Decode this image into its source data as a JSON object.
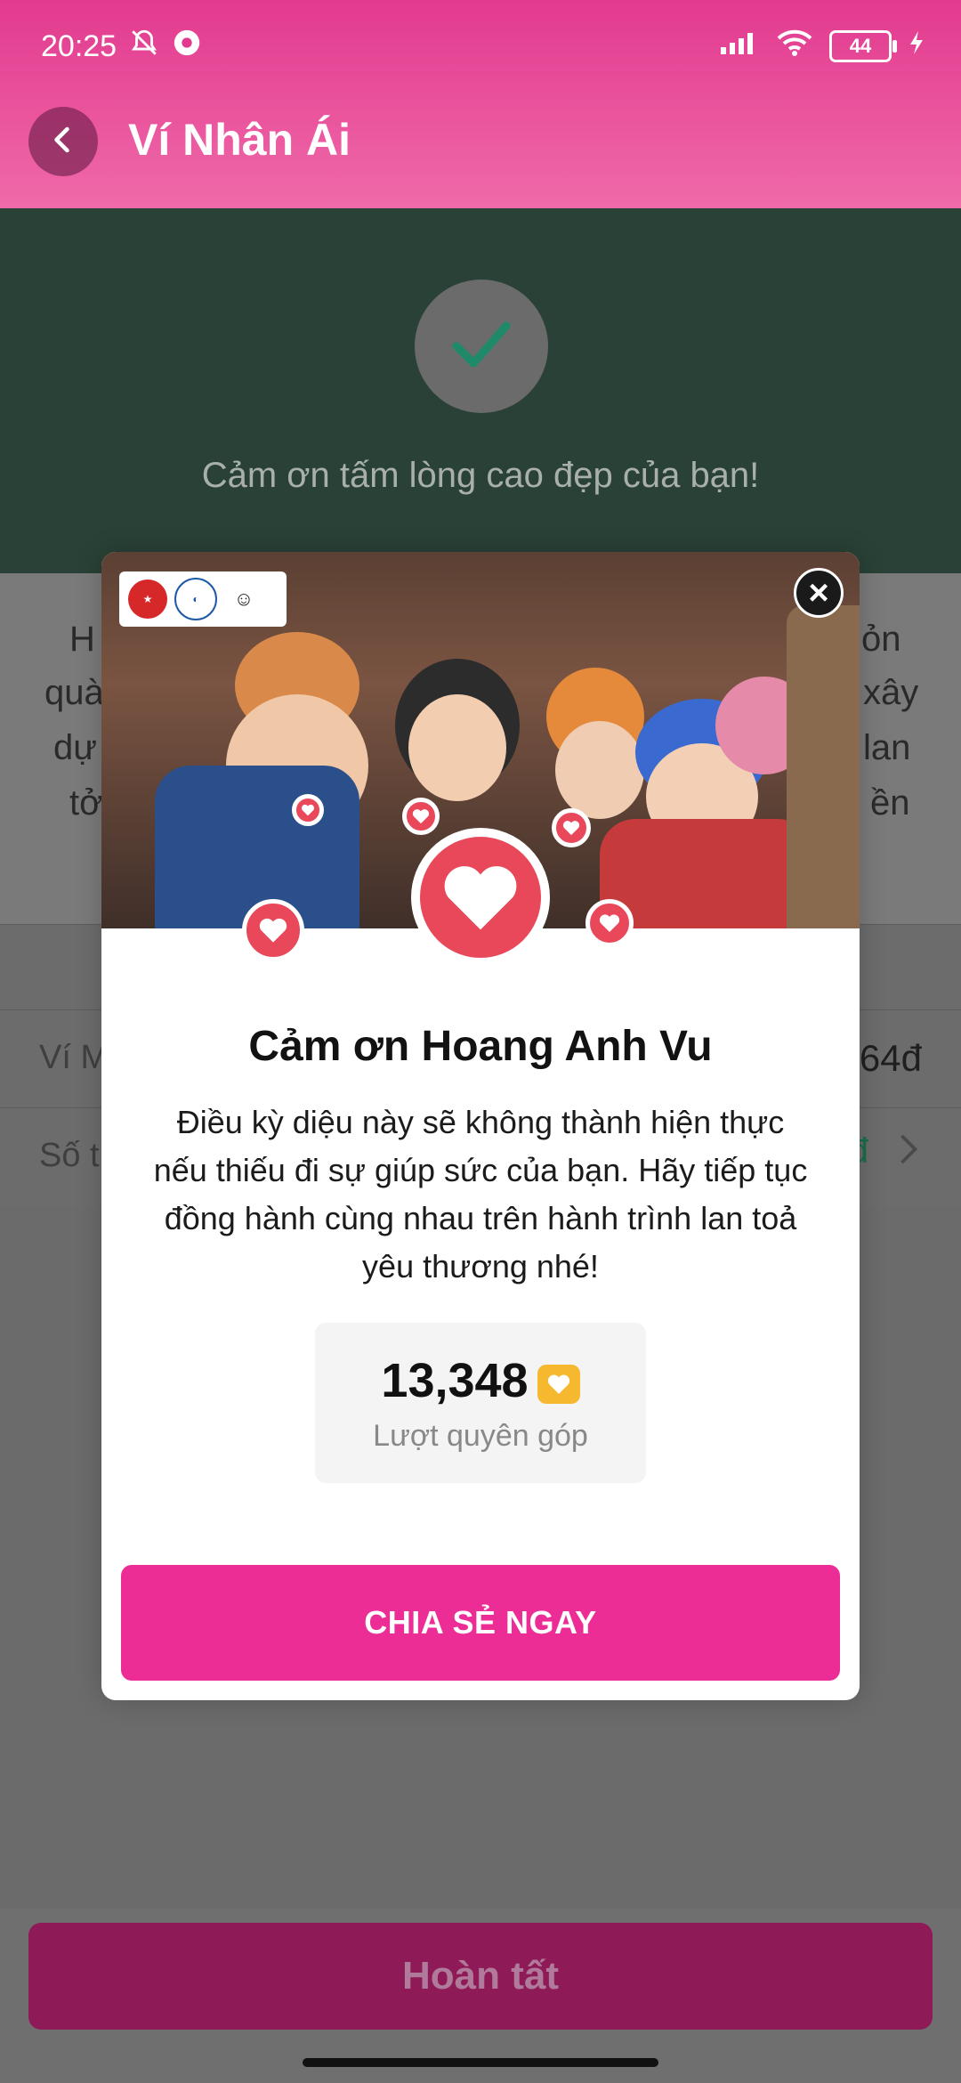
{
  "status_bar": {
    "time": "20:25",
    "battery": "44"
  },
  "header": {
    "title": "Ví Nhân Ái"
  },
  "banner": {
    "thanks_text": "Cảm ơn tấm lòng cao đẹp của bạn!"
  },
  "background_rows": {
    "desc_fragments": [
      "H",
      "quà",
      "dự",
      "tở",
      "ỏn",
      "xây",
      "lan",
      "ền"
    ],
    "row1_label": "Ví M",
    "row1_value": "64đ",
    "row2_label": "Số t"
  },
  "modal": {
    "title": "Cảm ơn Hoang Anh Vu",
    "message": "Điều kỳ diệu này sẽ không thành hiện thực nếu thiếu đi sự giúp sức của bạn. Hãy tiếp tục đồng hành cùng nhau trên hành trình lan toả yêu thương nhé!",
    "donation_count": "13,348",
    "donation_label": "Lượt quyên góp",
    "share_button": "CHIA SẺ NGAY"
  },
  "footer": {
    "done_button": "Hoàn tất"
  },
  "colors": {
    "brand_pink": "#ec2d95",
    "heart_red": "#e8485a",
    "banner_green": "#294136"
  },
  "icons": [
    "back-arrow-icon",
    "check-icon",
    "close-icon",
    "heart-icon",
    "coin-heart-icon",
    "bell-off-icon",
    "signal-icon",
    "wifi-icon",
    "battery-icon"
  ]
}
